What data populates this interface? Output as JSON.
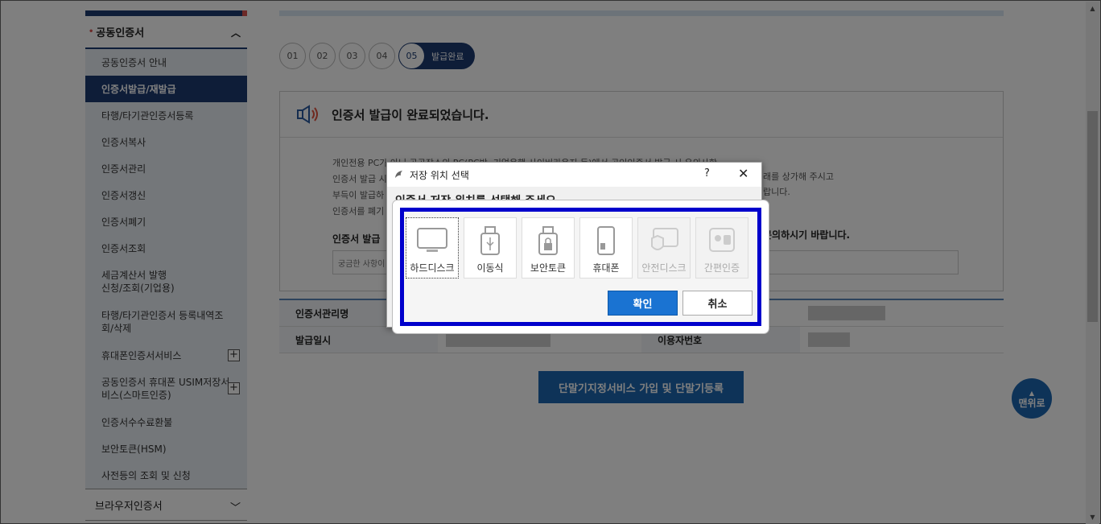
{
  "sidebar": {
    "header": "공동인증서",
    "items": [
      {
        "label": "공동인증서 안내"
      },
      {
        "label": "인증서발급/재발급",
        "active": true
      },
      {
        "label": "타행/타기관인증서등록"
      },
      {
        "label": "인증서복사"
      },
      {
        "label": "인증서관리"
      },
      {
        "label": "인증서갱신"
      },
      {
        "label": "인증서폐기"
      },
      {
        "label": "인증서조회"
      },
      {
        "label": "세금계산서 발행\n신청/조회(기업용)"
      },
      {
        "label": "타행/타기관인증서 등록내역조\n회/삭제"
      },
      {
        "label": "휴대폰인증서서비스"
      },
      {
        "label": "공동인증서 휴대폰 USIM저장서\n비스(스마트인증)"
      },
      {
        "label": "인증서수수료환불"
      },
      {
        "label": "보안토큰(HSM)"
      },
      {
        "label": "사전등의 조회 및 신청"
      }
    ],
    "footer": "브라우저인증서"
  },
  "steps": {
    "items": [
      "01",
      "02",
      "03",
      "04"
    ],
    "current_num": "05",
    "current_label": "발급완료"
  },
  "notice": {
    "title": "인증서 발급이 완료되었습니다.",
    "lines": [
      "개인전용 PC가 아닌 공공장소의 PC(PC방, 기업은행 사이버라운지 등)에서 공인인증서 발급 시 유의사항",
      "인증서 발급 시",
      "부득이 발급하",
      "인증서를 폐기"
    ],
    "right_1": "래를 상가해 주시고",
    "right_2": "랍니다.",
    "bold_left": "인증서 발급 ",
    "bold_right": "문의하시기 바랍니다.",
    "faq_placeholder": "궁금한 사항이"
  },
  "info": {
    "row1_label": "인증서관리명",
    "row2_label": "발급일시",
    "row2_label_b": "이용자번호"
  },
  "register_button": "단말기지정서비스 가입 및 단말기등록",
  "top_button": "맨위로",
  "dialog": {
    "title": "저장 위치 선택",
    "help": "?",
    "close": "✕",
    "instruction": "인증서 저장 위치를 선택해 주세요.",
    "devices": [
      {
        "label": "하드디스크",
        "icon": "monitor-icon",
        "selected": true,
        "disabled": false
      },
      {
        "label": "이동식",
        "icon": "usb-icon",
        "selected": false,
        "disabled": false
      },
      {
        "label": "보안토큰",
        "icon": "token-lock-icon",
        "selected": false,
        "disabled": false
      },
      {
        "label": "휴대폰",
        "icon": "phone-icon",
        "selected": false,
        "disabled": false
      },
      {
        "label": "안전디스크",
        "icon": "safe-disk-icon",
        "selected": false,
        "disabled": true
      },
      {
        "label": "간편인증",
        "icon": "mobile-os-icon",
        "selected": false,
        "disabled": true
      }
    ],
    "ok": "확인",
    "cancel": "취소",
    "highlight_color": "#0000cc"
  }
}
